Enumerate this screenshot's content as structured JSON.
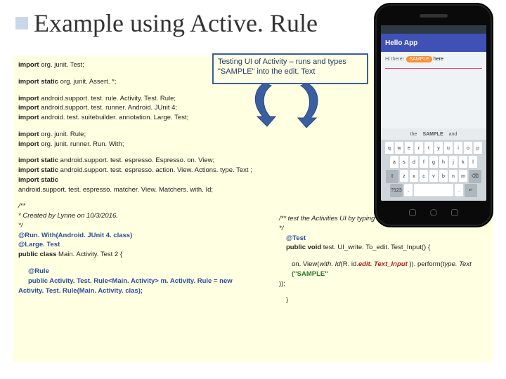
{
  "title": "Example using Active. Rule",
  "bluebox": "Testing UI of Activity – runs and types \"SAMPLE\" into the edit. Text",
  "code": {
    "l1_kw": "import",
    "l1_rest": " org. junit. Test;",
    "l2_kw": "import static",
    "l2_rest": " org. junit. Assert. *;",
    "l3_kw": "import",
    "l3_rest": " android.support. test. rule. Activity. Test. Rule;",
    "l4_kw": "import",
    "l4_rest": " android.support. test. runner. Android. JUnit 4;",
    "l5_kw": "import",
    "l5_rest": " android. test. suitebuilder. annotation. Large. Test;",
    "l6_kw": "import",
    "l6_rest": " org. junit. Rule;",
    "l7_kw": "import",
    "l7_rest": " org. junit. runner. Run. With;",
    "l8_kw": "import static",
    "l8_rest": " android.support. test. espresso. Espresso. on. View;",
    "l9_kw": "import static",
    "l9_rest": " android.support. test. espresso. action. View. Actions. type. Text ;",
    "l10_kw": "import static",
    "l10_rest": "",
    "l10b": "android.support. test. espresso. matcher. View. Matchers. with. Id;",
    "c1": "/**",
    "c2": " * Created by Lynne on 10/3/2016.",
    "c3": " */",
    "a1": "@Run. With",
    "a1p": "(Android. JUnit 4. class)",
    "a2": "@Large. Test",
    "cls_kw": "public class",
    "cls_name": " Main. Activity. Test 2 {",
    "rule": "@Rule",
    "rule_kw": "public",
    "rule_type": " Activity. Test. Rule<Main. Activity>",
    "rule_var": " m. Activity. Rule = ",
    "rule_new": "new",
    "rule2": "Activity. Test. Rule(Main. Activity. clas);",
    "r_c1": "/** test the Activities UI by typing into the edit. Text_Input text field",
    "r_c2": "*/",
    "r_test": "@Test",
    "r_m_kw": "public void",
    "r_m_name": " test. UI_write. To_edit. Test_Input() {",
    "r_call1": "on. View(",
    "r_call2": "with. Id",
    "r_call3": "(R. id.",
    "r_id": "edit. Text_Input",
    "r_call4": " )). perform(",
    "r_call5": "type. Text ",
    "r_str": "(\"SAMPLE\"",
    "r_tail": "));",
    "r_close": "}"
  },
  "phone": {
    "app_title": "Hello App",
    "hello": "Hi there!",
    "sample": "SAMPLE",
    "here": "here",
    "suggest1": "the",
    "suggest2": "SAMPLE",
    "suggest3": "and",
    "row1": [
      "q",
      "w",
      "e",
      "r",
      "t",
      "y",
      "u",
      "i",
      "o",
      "p"
    ],
    "row2": [
      "a",
      "s",
      "d",
      "f",
      "g",
      "h",
      "j",
      "k",
      "l"
    ],
    "row3": [
      "⇧",
      "z",
      "x",
      "c",
      "v",
      "b",
      "n",
      "m",
      "⌫"
    ],
    "row4_sym": "?123",
    "row4_comma": ",",
    "row4_dot": ".",
    "row4_enter": "↵"
  }
}
